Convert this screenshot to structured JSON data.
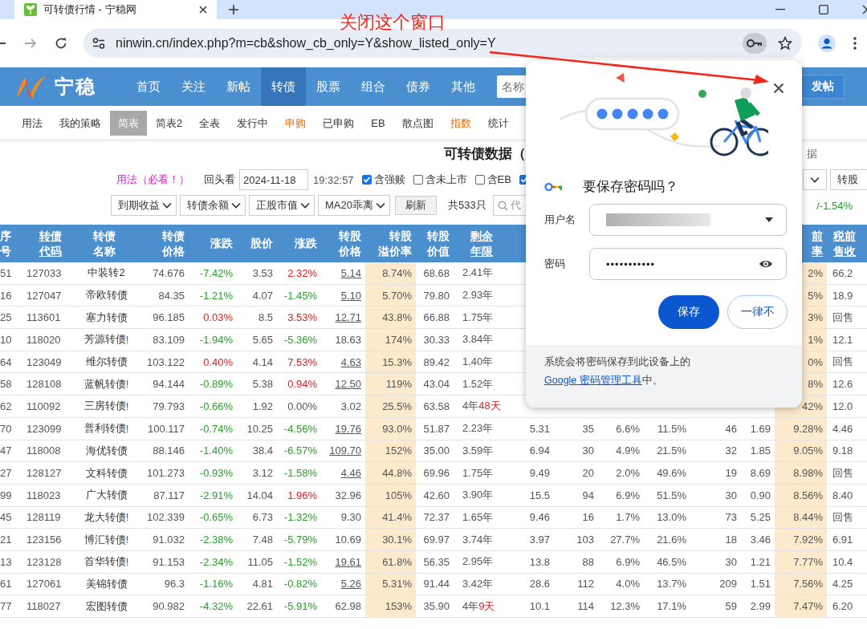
{
  "browser": {
    "tab_title": "可转债行情 - 宁稳网",
    "url": "ninwin.cn/index.php?m=cb&show_cb_only=Y&show_listed_only=Y"
  },
  "annotation": {
    "text": "关闭这个窗口"
  },
  "site": {
    "logo": "宁稳",
    "search_placeholder": "名称",
    "post_button": "发帖",
    "nav": [
      {
        "label": "首页",
        "selected": false
      },
      {
        "label": "关注",
        "selected": false
      },
      {
        "label": "新帖",
        "selected": false
      },
      {
        "label": "转债",
        "selected": true
      },
      {
        "label": "股票",
        "selected": false
      },
      {
        "label": "组合",
        "selected": false
      },
      {
        "label": "债券",
        "selected": false
      },
      {
        "label": "其他",
        "selected": false
      }
    ]
  },
  "subnav": [
    {
      "label": "用法",
      "selected": false,
      "highlight": false
    },
    {
      "label": "我的策略",
      "selected": false,
      "highlight": false
    },
    {
      "label": "简表",
      "selected": true,
      "highlight": false
    },
    {
      "label": "简表2",
      "selected": false,
      "highlight": false
    },
    {
      "label": "全表",
      "selected": false,
      "highlight": false
    },
    {
      "label": "发行中",
      "selected": false,
      "highlight": false
    },
    {
      "label": "申购",
      "selected": false,
      "highlight": true
    },
    {
      "label": "已申购",
      "selected": false,
      "highlight": false
    },
    {
      "label": "EB",
      "selected": false,
      "highlight": false
    },
    {
      "label": "散点图",
      "selected": false,
      "highlight": false
    },
    {
      "label": "指数",
      "selected": false,
      "highlight": true
    },
    {
      "label": "统计",
      "selected": false,
      "highlight": false
    }
  ],
  "page_title": "可转债数据（",
  "title_side": "据",
  "controls": {
    "usage_link": "用法（必看！）",
    "lookback_label": "回头看",
    "date": "2024-11-18",
    "time": "19:32:57",
    "checkboxes": [
      {
        "label": "含强赎",
        "checked": true
      },
      {
        "label": "含未上市",
        "checked": false
      },
      {
        "label": "含EB",
        "checked": false
      },
      {
        "checked": true
      }
    ],
    "selects": [
      "到期收益",
      "转债余额",
      "正股市值",
      "MA20乖离"
    ],
    "refresh": "刷新",
    "count": "共533只",
    "search_placeholder": "代",
    "right_select": "转股",
    "range": "/-1.54%"
  },
  "table": {
    "columns": [
      {
        "lines": [
          "序",
          "号"
        ],
        "sortable": false
      },
      {
        "lines": [
          "转债",
          "代码"
        ],
        "sortable": true
      },
      {
        "lines": [
          "转债",
          "名称"
        ],
        "sortable": false
      },
      {
        "lines": [
          "转债",
          "价格"
        ],
        "sortable": false
      },
      {
        "lines": [
          "涨跌"
        ],
        "sortable": false
      },
      {
        "lines": [
          "股价"
        ],
        "sortable": false
      },
      {
        "lines": [
          "涨跌"
        ],
        "sortable": false
      },
      {
        "lines": [
          "转股",
          "价格"
        ],
        "sortable": false
      },
      {
        "lines": [
          "转股",
          "溢价率"
        ],
        "sortable": false
      },
      {
        "lines": [
          "转股",
          "价值"
        ],
        "sortable": false
      },
      {
        "lines": [
          "剩余",
          "年限"
        ],
        "sortable": true
      }
    ],
    "columns_right": [
      {
        "lines": [
          "前",
          "率"
        ],
        "sortable": true
      },
      {
        "lines": [
          "税前",
          "售收"
        ],
        "sortable": true
      }
    ],
    "rows": [
      {
        "seq": "51",
        "code": "127033",
        "name": "中装转2",
        "price": "74.676",
        "chg": {
          "text": "-7.42%",
          "color": "#2a9d2a"
        },
        "stock": "3.53",
        "stock_chg": {
          "text": "2.32%",
          "color": "#e02020"
        },
        "conv": "5.14",
        "conv_link": true,
        "premium": "8.74%",
        "value": "68.68",
        "remain": "2.41年",
        "ytm": "2%",
        "put": "66.2"
      },
      {
        "seq": "16",
        "code": "127047",
        "name": "帝欧转债",
        "price": "84.35",
        "chg": {
          "text": "-1.21%",
          "color": "#2a9d2a"
        },
        "stock": "4.07",
        "stock_chg": {
          "text": "-1.45%",
          "color": "#2a9d2a"
        },
        "conv": "5.10",
        "conv_link": true,
        "premium": "5.70%",
        "value": "79.80",
        "remain": "2.93年",
        "ytm": "5%",
        "put": "18.9"
      },
      {
        "seq": "25",
        "code": "113601",
        "name": "塞力转债",
        "price": "96.185",
        "chg": {
          "text": "0.03%",
          "color": "#e02020"
        },
        "stock": "8.5",
        "stock_chg": {
          "text": "3.53%",
          "color": "#e02020"
        },
        "conv": "12.71",
        "conv_link": true,
        "premium": "43.8%",
        "value": "66.88",
        "remain": "1.75年",
        "ytm": "3%",
        "put": "回售"
      },
      {
        "seq": "10",
        "code": "118020",
        "name": "芳源转债",
        "mark": "!",
        "price": "83.109",
        "chg": {
          "text": "-1.94%",
          "color": "#2a9d2a"
        },
        "stock": "5.65",
        "stock_chg": {
          "text": "-5.36%",
          "color": "#2a9d2a"
        },
        "conv": "18.63",
        "conv_link": false,
        "premium": "174%",
        "value": "30.33",
        "remain": "3.84年",
        "ytm": "1%",
        "put": "12.1"
      },
      {
        "seq": "64",
        "code": "123049",
        "name": "维尔转债",
        "price": "103.122",
        "chg": {
          "text": "0.40%",
          "color": "#e02020"
        },
        "stock": "4.14",
        "stock_chg": {
          "text": "7.53%",
          "color": "#e02020"
        },
        "conv": "4.63",
        "conv_link": true,
        "premium": "15.3%",
        "value": "89.42",
        "remain": "1.40年",
        "ytm": "0%",
        "put": "回售"
      },
      {
        "seq": "58",
        "code": "128108",
        "name": "蓝帆转债",
        "mark": "!",
        "price": "94.144",
        "chg": {
          "text": "-0.89%",
          "color": "#2a9d2a"
        },
        "stock": "5.38",
        "stock_chg": {
          "text": "0.94%",
          "color": "#e02020"
        },
        "conv": "12.50",
        "conv_link": true,
        "premium": "119%",
        "value": "43.04",
        "remain": "1.52年",
        "ytm": "8%",
        "put": "12.6"
      },
      {
        "seq": "62",
        "code": "110092",
        "name": "三房转债",
        "mark": "!",
        "price": "79.793",
        "chg": {
          "text": "-0.66%",
          "color": "#2a9d2a"
        },
        "stock": "1.92",
        "stock_chg": {
          "text": "0.00%",
          "color": "#555555"
        },
        "conv": "3.02",
        "conv_link": false,
        "premium": "25.5%",
        "value": "63.58",
        "remain": "4年",
        "remain_extra": "48天",
        "ytm": "42%",
        "put": "12.0"
      },
      {
        "seq": "70",
        "code": "123099",
        "name": "普利转债",
        "mark": "!",
        "price": "100.117",
        "chg": {
          "text": "-0.74%",
          "color": "#2a9d2a"
        },
        "stock": "10.25",
        "stock_chg": {
          "text": "-4.56%",
          "color": "#2a9d2a"
        },
        "conv": "19.76",
        "conv_link": true,
        "premium": "93.0%",
        "value": "51.87",
        "remain": "2.23年",
        "extra": [
          "5.31",
          "35",
          "6.6%",
          "11.5%",
          "46",
          "1.69"
        ],
        "ytm": "9.28%",
        "put": "4.46"
      },
      {
        "seq": "47",
        "code": "118008",
        "name": "海优转债",
        "price": "88.146",
        "chg": {
          "text": "-1.40%",
          "color": "#2a9d2a"
        },
        "stock": "38.4",
        "stock_chg": {
          "text": "-6.57%",
          "color": "#2a9d2a"
        },
        "conv": "109.70",
        "conv_link": true,
        "premium": "152%",
        "value": "35.00",
        "remain": "3.59年",
        "extra": [
          "6.94",
          "30",
          "4.9%",
          "21.5%",
          "32",
          "1.85"
        ],
        "ytm": "9.05%",
        "put": "9.18"
      },
      {
        "seq": "27",
        "code": "128127",
        "name": "文科转债",
        "price": "101.273",
        "chg": {
          "text": "-0.93%",
          "color": "#2a9d2a"
        },
        "stock": "3.12",
        "stock_chg": {
          "text": "-1.58%",
          "color": "#2a9d2a"
        },
        "conv": "4.46",
        "conv_link": true,
        "premium": "44.8%",
        "value": "69.96",
        "remain": "1.75年",
        "extra": [
          "9.49",
          "20",
          "2.0%",
          "49.6%",
          "19",
          "8.69"
        ],
        "ytm": "8.98%",
        "put": "回售"
      },
      {
        "seq": "99",
        "code": "118023",
        "name": "广大转债",
        "price": "87.117",
        "chg": {
          "text": "-2.91%",
          "color": "#2a9d2a"
        },
        "stock": "14.04",
        "stock_chg": {
          "text": "1.96%",
          "color": "#e02020"
        },
        "conv": "32.96",
        "conv_link": false,
        "premium": "105%",
        "value": "42.60",
        "remain": "3.90年",
        "extra": [
          "15.5",
          "94",
          "6.9%",
          "51.5%",
          "30",
          "0.90"
        ],
        "ytm": "8.56%",
        "put": "8.40"
      },
      {
        "seq": "45",
        "code": "128119",
        "name": "龙大转债",
        "mark": "!",
        "price": "102.339",
        "chg": {
          "text": "-0.65%",
          "color": "#2a9d2a"
        },
        "stock": "6.73",
        "stock_chg": {
          "text": "-1.32%",
          "color": "#2a9d2a"
        },
        "conv": "9.30",
        "conv_link": false,
        "premium": "41.4%",
        "value": "72.37",
        "remain": "1.65年",
        "extra": [
          "9.46",
          "16",
          "1.7%",
          "13.0%",
          "73",
          "5.25"
        ],
        "ytm": "8.44%",
        "put": "回售"
      },
      {
        "seq": "21",
        "code": "123156",
        "name": "博汇转债",
        "mark": "!",
        "price": "91.032",
        "chg": {
          "text": "-2.38%",
          "color": "#2a9d2a"
        },
        "stock": "7.48",
        "stock_chg": {
          "text": "-5.79%",
          "color": "#2a9d2a"
        },
        "conv": "10.69",
        "conv_link": false,
        "premium": "30.1%",
        "value": "69.97",
        "remain": "3.74年",
        "extra": [
          "3.97",
          "103",
          "27.7%",
          "21.6%",
          "18",
          "3.46"
        ],
        "ytm": "7.92%",
        "put": "6.91"
      },
      {
        "seq": "13",
        "code": "123128",
        "name": "首华转债",
        "mark": "!",
        "price": "91.153",
        "chg": {
          "text": "-2.34%",
          "color": "#2a9d2a"
        },
        "stock": "11.05",
        "stock_chg": {
          "text": "-1.52%",
          "color": "#2a9d2a"
        },
        "conv": "19.61",
        "conv_link": true,
        "premium": "61.8%",
        "value": "56.35",
        "remain": "2.95年",
        "extra": [
          "13.8",
          "88",
          "6.9%",
          "46.5%",
          "30",
          "1.21"
        ],
        "ytm": "7.77%",
        "put": "10.4"
      },
      {
        "seq": "61",
        "code": "127061",
        "name": "美锦转债",
        "price": "96.3",
        "chg": {
          "text": "-1.16%",
          "color": "#2a9d2a"
        },
        "stock": "4.81",
        "stock_chg": {
          "text": "-0.82%",
          "color": "#2a9d2a"
        },
        "conv": "5.26",
        "conv_link": true,
        "premium": "5.31%",
        "value": "91.44",
        "remain": "3.42年",
        "extra": [
          "28.6",
          "112",
          "4.0%",
          "13.7%",
          "209",
          "1.51"
        ],
        "ytm": "7.56%",
        "put": "4.25"
      },
      {
        "seq": "77",
        "code": "118027",
        "name": "宏图转债",
        "price": "90.982",
        "chg": {
          "text": "-4.32%",
          "color": "#2a9d2a"
        },
        "stock": "22.61",
        "stock_chg": {
          "text": "-5.91%",
          "color": "#2a9d2a"
        },
        "conv": "62.98",
        "conv_link": false,
        "premium": "153%",
        "value": "35.90",
        "remain": "4年",
        "remain_extra": "9天",
        "extra": [
          "10.1",
          "114",
          "12.3%",
          "17.1%",
          "59",
          "2.99"
        ],
        "ytm": "7.47%",
        "put": "6.20"
      }
    ]
  },
  "dialog": {
    "title": "要保存密码吗？",
    "username_label": "用户名",
    "password_label": "密码",
    "password_value": "•••••••••••",
    "buttons": [
      {
        "label": "保存",
        "primary": true
      },
      {
        "label": "一律不",
        "primary": false
      }
    ],
    "footer": {
      "before": "系统会将密码保存到此设备上的 ",
      "link": "Google 密码管理工具",
      "after": "中。"
    }
  }
}
